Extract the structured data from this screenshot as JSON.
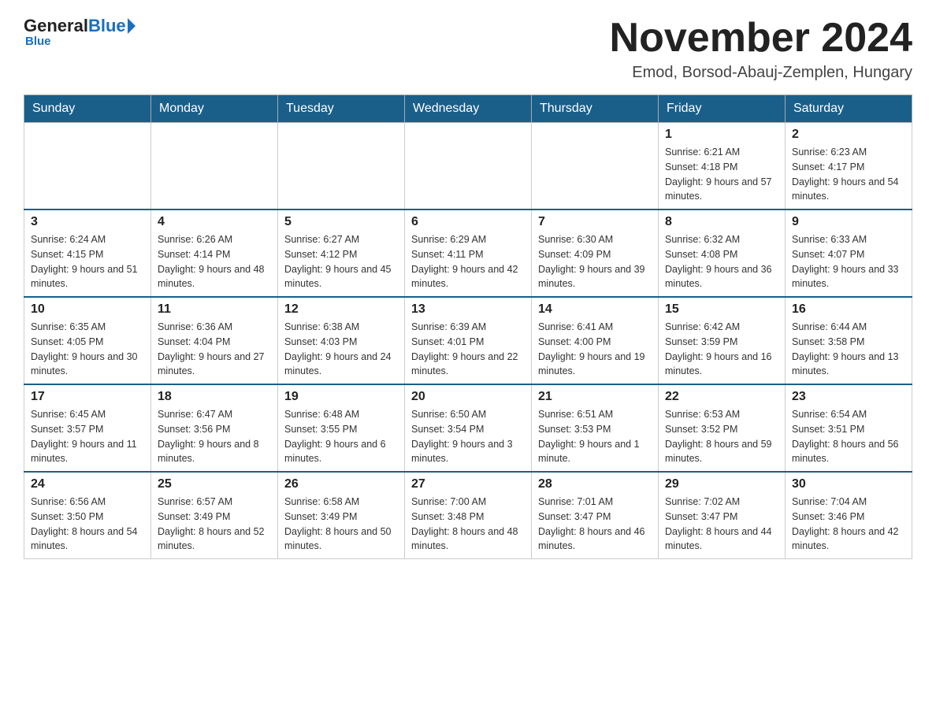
{
  "header": {
    "logo_general": "General",
    "logo_blue": "Blue",
    "month_title": "November 2024",
    "location": "Emod, Borsod-Abauj-Zemplen, Hungary"
  },
  "weekdays": [
    "Sunday",
    "Monday",
    "Tuesday",
    "Wednesday",
    "Thursday",
    "Friday",
    "Saturday"
  ],
  "weeks": [
    [
      {
        "day": "",
        "sunrise": "",
        "sunset": "",
        "daylight": ""
      },
      {
        "day": "",
        "sunrise": "",
        "sunset": "",
        "daylight": ""
      },
      {
        "day": "",
        "sunrise": "",
        "sunset": "",
        "daylight": ""
      },
      {
        "day": "",
        "sunrise": "",
        "sunset": "",
        "daylight": ""
      },
      {
        "day": "",
        "sunrise": "",
        "sunset": "",
        "daylight": ""
      },
      {
        "day": "1",
        "sunrise": "Sunrise: 6:21 AM",
        "sunset": "Sunset: 4:18 PM",
        "daylight": "Daylight: 9 hours and 57 minutes."
      },
      {
        "day": "2",
        "sunrise": "Sunrise: 6:23 AM",
        "sunset": "Sunset: 4:17 PM",
        "daylight": "Daylight: 9 hours and 54 minutes."
      }
    ],
    [
      {
        "day": "3",
        "sunrise": "Sunrise: 6:24 AM",
        "sunset": "Sunset: 4:15 PM",
        "daylight": "Daylight: 9 hours and 51 minutes."
      },
      {
        "day": "4",
        "sunrise": "Sunrise: 6:26 AM",
        "sunset": "Sunset: 4:14 PM",
        "daylight": "Daylight: 9 hours and 48 minutes."
      },
      {
        "day": "5",
        "sunrise": "Sunrise: 6:27 AM",
        "sunset": "Sunset: 4:12 PM",
        "daylight": "Daylight: 9 hours and 45 minutes."
      },
      {
        "day": "6",
        "sunrise": "Sunrise: 6:29 AM",
        "sunset": "Sunset: 4:11 PM",
        "daylight": "Daylight: 9 hours and 42 minutes."
      },
      {
        "day": "7",
        "sunrise": "Sunrise: 6:30 AM",
        "sunset": "Sunset: 4:09 PM",
        "daylight": "Daylight: 9 hours and 39 minutes."
      },
      {
        "day": "8",
        "sunrise": "Sunrise: 6:32 AM",
        "sunset": "Sunset: 4:08 PM",
        "daylight": "Daylight: 9 hours and 36 minutes."
      },
      {
        "day": "9",
        "sunrise": "Sunrise: 6:33 AM",
        "sunset": "Sunset: 4:07 PM",
        "daylight": "Daylight: 9 hours and 33 minutes."
      }
    ],
    [
      {
        "day": "10",
        "sunrise": "Sunrise: 6:35 AM",
        "sunset": "Sunset: 4:05 PM",
        "daylight": "Daylight: 9 hours and 30 minutes."
      },
      {
        "day": "11",
        "sunrise": "Sunrise: 6:36 AM",
        "sunset": "Sunset: 4:04 PM",
        "daylight": "Daylight: 9 hours and 27 minutes."
      },
      {
        "day": "12",
        "sunrise": "Sunrise: 6:38 AM",
        "sunset": "Sunset: 4:03 PM",
        "daylight": "Daylight: 9 hours and 24 minutes."
      },
      {
        "day": "13",
        "sunrise": "Sunrise: 6:39 AM",
        "sunset": "Sunset: 4:01 PM",
        "daylight": "Daylight: 9 hours and 22 minutes."
      },
      {
        "day": "14",
        "sunrise": "Sunrise: 6:41 AM",
        "sunset": "Sunset: 4:00 PM",
        "daylight": "Daylight: 9 hours and 19 minutes."
      },
      {
        "day": "15",
        "sunrise": "Sunrise: 6:42 AM",
        "sunset": "Sunset: 3:59 PM",
        "daylight": "Daylight: 9 hours and 16 minutes."
      },
      {
        "day": "16",
        "sunrise": "Sunrise: 6:44 AM",
        "sunset": "Sunset: 3:58 PM",
        "daylight": "Daylight: 9 hours and 13 minutes."
      }
    ],
    [
      {
        "day": "17",
        "sunrise": "Sunrise: 6:45 AM",
        "sunset": "Sunset: 3:57 PM",
        "daylight": "Daylight: 9 hours and 11 minutes."
      },
      {
        "day": "18",
        "sunrise": "Sunrise: 6:47 AM",
        "sunset": "Sunset: 3:56 PM",
        "daylight": "Daylight: 9 hours and 8 minutes."
      },
      {
        "day": "19",
        "sunrise": "Sunrise: 6:48 AM",
        "sunset": "Sunset: 3:55 PM",
        "daylight": "Daylight: 9 hours and 6 minutes."
      },
      {
        "day": "20",
        "sunrise": "Sunrise: 6:50 AM",
        "sunset": "Sunset: 3:54 PM",
        "daylight": "Daylight: 9 hours and 3 minutes."
      },
      {
        "day": "21",
        "sunrise": "Sunrise: 6:51 AM",
        "sunset": "Sunset: 3:53 PM",
        "daylight": "Daylight: 9 hours and 1 minute."
      },
      {
        "day": "22",
        "sunrise": "Sunrise: 6:53 AM",
        "sunset": "Sunset: 3:52 PM",
        "daylight": "Daylight: 8 hours and 59 minutes."
      },
      {
        "day": "23",
        "sunrise": "Sunrise: 6:54 AM",
        "sunset": "Sunset: 3:51 PM",
        "daylight": "Daylight: 8 hours and 56 minutes."
      }
    ],
    [
      {
        "day": "24",
        "sunrise": "Sunrise: 6:56 AM",
        "sunset": "Sunset: 3:50 PM",
        "daylight": "Daylight: 8 hours and 54 minutes."
      },
      {
        "day": "25",
        "sunrise": "Sunrise: 6:57 AM",
        "sunset": "Sunset: 3:49 PM",
        "daylight": "Daylight: 8 hours and 52 minutes."
      },
      {
        "day": "26",
        "sunrise": "Sunrise: 6:58 AM",
        "sunset": "Sunset: 3:49 PM",
        "daylight": "Daylight: 8 hours and 50 minutes."
      },
      {
        "day": "27",
        "sunrise": "Sunrise: 7:00 AM",
        "sunset": "Sunset: 3:48 PM",
        "daylight": "Daylight: 8 hours and 48 minutes."
      },
      {
        "day": "28",
        "sunrise": "Sunrise: 7:01 AM",
        "sunset": "Sunset: 3:47 PM",
        "daylight": "Daylight: 8 hours and 46 minutes."
      },
      {
        "day": "29",
        "sunrise": "Sunrise: 7:02 AM",
        "sunset": "Sunset: 3:47 PM",
        "daylight": "Daylight: 8 hours and 44 minutes."
      },
      {
        "day": "30",
        "sunrise": "Sunrise: 7:04 AM",
        "sunset": "Sunset: 3:46 PM",
        "daylight": "Daylight: 8 hours and 42 minutes."
      }
    ]
  ]
}
